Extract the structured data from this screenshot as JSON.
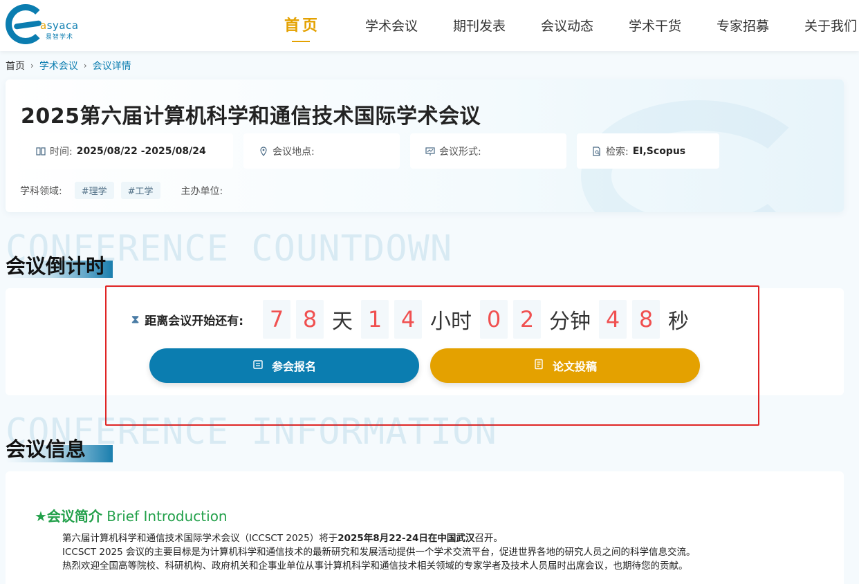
{
  "logo": {
    "brand_a": "a",
    "brand_rest": "syaca",
    "sub": "易智学术"
  },
  "nav": [
    {
      "label": "首页",
      "active": true
    },
    {
      "label": "学术会议"
    },
    {
      "label": "期刊发表"
    },
    {
      "label": "会议动态"
    },
    {
      "label": "学术干货"
    },
    {
      "label": "专家招募"
    },
    {
      "label": "关于我们"
    }
  ],
  "breadcrumb": {
    "home": "首页",
    "level1": "学术会议",
    "level2": "会议详情"
  },
  "conference": {
    "title": "2025第六届计算机科学和通信技术国际学术会议",
    "time_label": "时间:",
    "time_value": "2025/08/22 -2025/08/24",
    "location_label": "会议地点:",
    "location_value": "",
    "format_label": "会议形式:",
    "format_value": "",
    "index_label": "检索:",
    "index_value": "EI,Scopus",
    "field_label": "学科领域:",
    "tags": [
      "#理学",
      "#工学"
    ],
    "organizer_label": "主办单位:"
  },
  "countdown_section": {
    "bg_text": "CONFERENCE COUNTDOWN",
    "title": "会议倒计时"
  },
  "countdown": {
    "label": "距离会议开始还有:",
    "days": [
      "7",
      "8"
    ],
    "days_unit": "天",
    "hours": [
      "1",
      "4"
    ],
    "hours_unit": "小时",
    "minutes": [
      "0",
      "2"
    ],
    "minutes_unit": "分钟",
    "seconds": [
      "4",
      "8"
    ],
    "seconds_unit": "秒"
  },
  "buttons": {
    "register": "参会报名",
    "submit": "论文投稿"
  },
  "info_section": {
    "bg_text": "CONFERENCE INFORMATION",
    "title": "会议信息"
  },
  "intro": {
    "title_cn": "★会议简介",
    "title_en": " Brief Introduction",
    "line1_pre": "第六届计算机科学和通信技术国际学术会议（ICCSCT 2025）将于",
    "line1_bold": "2025年8月22-24日在中国武汉",
    "line1_post": "召开。",
    "line2": "ICCSCT 2025 会议的主要目标是为计算机科学和通信技术的最新研究和发展活动提供一个学术交流平台，促进世界各地的研究人员之间的科学信息交流。",
    "line3": "热烈欢迎全国高等院校、科研机构、政府机关和企事业单位从事计算机科学和通信技术相关领域的专家学者及技术人员届时出席会议，也期待您的贡献。"
  },
  "colors": {
    "primary": "#0b7db0",
    "accent": "#e4a100",
    "digit": "#f05050",
    "frame": "#e02424",
    "intro": "#22a04a"
  }
}
